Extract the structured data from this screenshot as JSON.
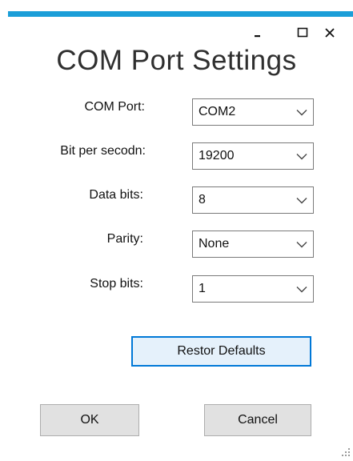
{
  "window": {
    "title": "COM Port Settings",
    "accent_color": "#1b9ed8",
    "controls": {
      "minimize_icon": "minimize-icon",
      "maximize_icon": "maximize-icon",
      "close_icon": "close-icon"
    }
  },
  "form": {
    "fields": [
      {
        "label": "COM Port:",
        "value": "COM2"
      },
      {
        "label": "Bit per secodn:",
        "value": "19200"
      },
      {
        "label": "Data bits:",
        "value": "8"
      },
      {
        "label": "Parity:",
        "value": "None"
      },
      {
        "label": "Stop bits:",
        "value": "1"
      }
    ]
  },
  "buttons": {
    "restore_defaults": "Restor Defaults",
    "ok": "OK",
    "cancel": "Cancel"
  }
}
